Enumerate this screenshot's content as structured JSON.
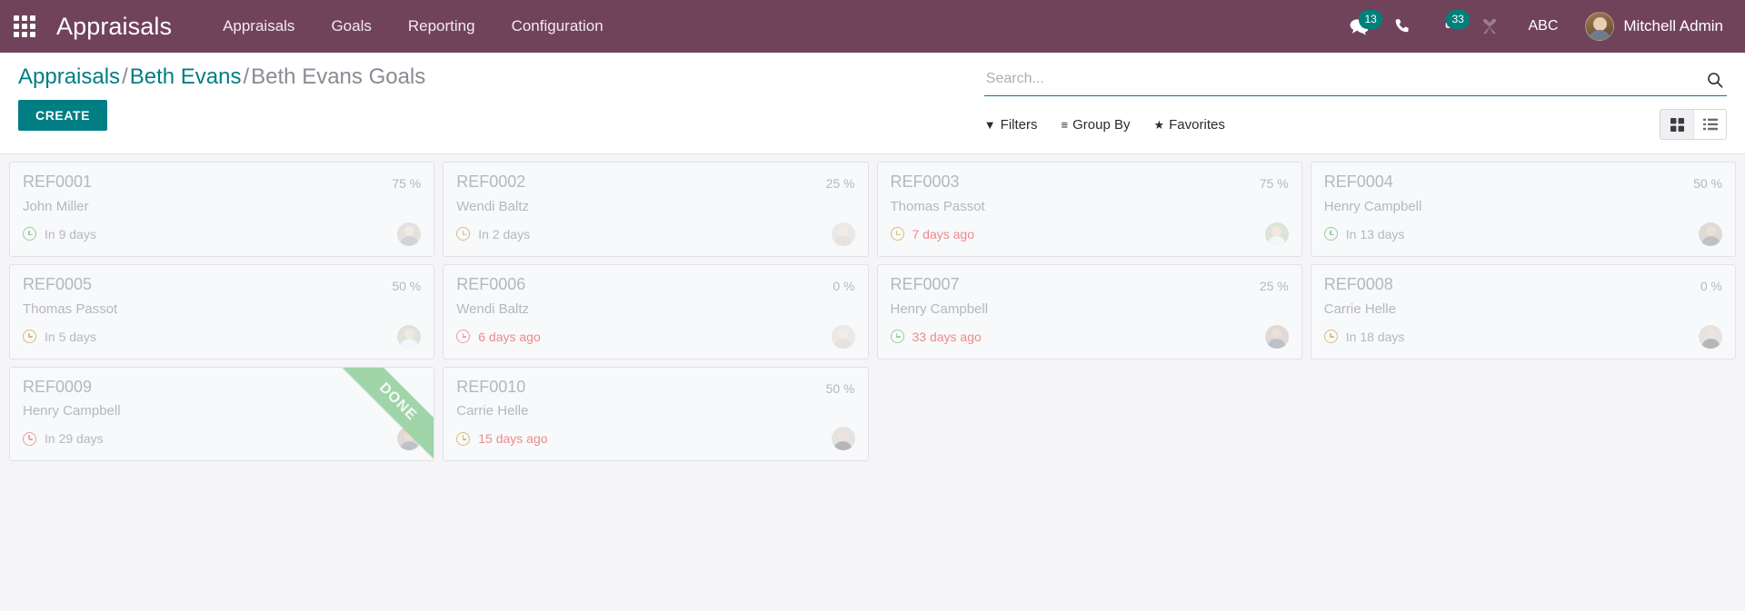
{
  "navbar": {
    "apps_icon": "apps-grid-icon",
    "brand": "Appraisals",
    "menu": [
      {
        "label": "Appraisals"
      },
      {
        "label": "Goals"
      },
      {
        "label": "Reporting"
      },
      {
        "label": "Configuration"
      }
    ],
    "messages_icon": "chat-bubble-icon",
    "messages_count": "13",
    "phone_icon": "phone-icon",
    "activities_icon": "clock-activity-icon",
    "activities_count": "33",
    "tools_icon": "wrench-icon",
    "company_label": "ABC",
    "avatar_icon": "user-avatar",
    "user_name": "Mitchell Admin",
    "accent_color": "#00807b",
    "bar_color": "#71435b"
  },
  "control_panel": {
    "breadcrumb": {
      "root": "Appraisals",
      "parent": "Beth Evans",
      "current": "Beth Evans Goals",
      "separator": "/"
    },
    "create_label": "CREATE",
    "search": {
      "placeholder": "Search...",
      "value": "",
      "icon": "search-icon"
    },
    "filters": [
      {
        "label": "Filters",
        "icon": "filter-funnel-icon",
        "glyph": "▼"
      },
      {
        "label": "Group By",
        "icon": "group-by-lines-icon",
        "glyph": "≡"
      },
      {
        "label": "Favorites",
        "icon": "star-icon",
        "glyph": "★"
      }
    ],
    "views": [
      {
        "name": "kanban-view",
        "icon": "kanban-grid-icon",
        "active": true
      },
      {
        "name": "list-view",
        "icon": "list-icon",
        "active": false
      }
    ]
  },
  "kanban": {
    "cards": [
      {
        "ref": "REF0001",
        "percent": "75 %",
        "person": "John Miller",
        "deadline": "In 9 days",
        "clock_color": "green",
        "text_color": "gray",
        "ribbon": null,
        "avatar": {
          "bg": "#c9c2b6",
          "head": "#e6d7c6",
          "body": "#9aa2ab"
        }
      },
      {
        "ref": "REF0002",
        "percent": "25 %",
        "person": "Wendi Baltz",
        "deadline": "In 2 days",
        "clock_color": "amber",
        "text_color": "gray",
        "ribbon": null,
        "avatar": {
          "bg": "#d8d2cc",
          "head": "#ecdcc9",
          "body": "#cfc4bb"
        }
      },
      {
        "ref": "REF0003",
        "percent": "75 %",
        "person": "Thomas Passot",
        "deadline": "7 days ago",
        "clock_color": "amber",
        "text_color": "red",
        "ribbon": null,
        "avatar": {
          "bg": "#b8c9a8",
          "head": "#e8d3bd",
          "body": "#eef0f2"
        }
      },
      {
        "ref": "REF0004",
        "percent": "50 %",
        "person": "Henry Campbell",
        "deadline": "In 13 days",
        "clock_color": "green",
        "text_color": "gray",
        "ribbon": null,
        "avatar": {
          "bg": "#bdb0a4",
          "head": "#d8bda4",
          "body": "#6d7887"
        }
      },
      {
        "ref": "REF0005",
        "percent": "50 %",
        "person": "Thomas Passot",
        "deadline": "In 5 days",
        "clock_color": "amber",
        "text_color": "gray",
        "ribbon": null,
        "avatar": {
          "bg": "#b8c9a8",
          "head": "#e8d3bd",
          "body": "#eef0f2"
        }
      },
      {
        "ref": "REF0006",
        "percent": "0 %",
        "person": "Wendi Baltz",
        "deadline": "6 days ago",
        "clock_color": "red",
        "text_color": "red",
        "ribbon": null,
        "avatar": {
          "bg": "#d8d2cc",
          "head": "#ecdcc9",
          "body": "#cfc4bb"
        }
      },
      {
        "ref": "REF0007",
        "percent": "25 %",
        "person": "Henry Campbell",
        "deadline": "33 days ago",
        "clock_color": "green",
        "text_color": "red",
        "ribbon": null,
        "avatar": {
          "bg": "#bdb0a4",
          "head": "#d8bda4",
          "body": "#6d7887"
        }
      },
      {
        "ref": "REF0008",
        "percent": "0 %",
        "person": "Carrie Helle",
        "deadline": "In 18 days",
        "clock_color": "amber",
        "text_color": "gray",
        "ribbon": null,
        "avatar": {
          "bg": "#cdc6c2",
          "head": "#e2c7b2",
          "body": "#5c5a63"
        }
      },
      {
        "ref": "REF0009",
        "percent": "",
        "person": "Henry Campbell",
        "deadline": "In 29 days",
        "clock_color": "red",
        "text_color": "gray",
        "ribbon": "DONE",
        "avatar": {
          "bg": "#bdb0a4",
          "head": "#d8bda4",
          "body": "#6d7887"
        }
      },
      {
        "ref": "REF0010",
        "percent": "50 %",
        "person": "Carrie Helle",
        "deadline": "15 days ago",
        "clock_color": "amber",
        "text_color": "red",
        "ribbon": null,
        "avatar": {
          "bg": "#cdc6c2",
          "head": "#e2c7b2",
          "body": "#5c5a63"
        }
      }
    ]
  }
}
